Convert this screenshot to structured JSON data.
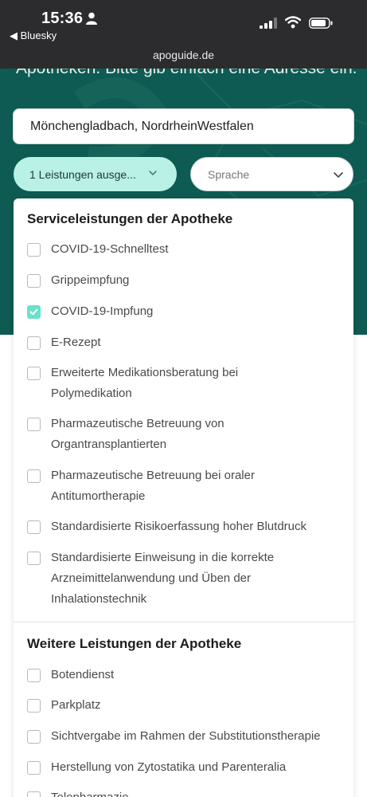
{
  "status_bar": {
    "time": "15:36",
    "back_app": "◀ Bluesky"
  },
  "browser": {
    "url": "apoguide.de"
  },
  "hero": {
    "text": "Apotheken. Bitte gib einfach eine Adresse ein.",
    "address_value": "Mönchengladbach, NordrheinWestfalen"
  },
  "filters": {
    "services_label": "1 Leistungen ausge...",
    "language_placeholder": "Sprache"
  },
  "sections": {
    "service": {
      "title": "Serviceleistungen der Apotheke",
      "items": [
        {
          "label": "COVID-19-Schnelltest",
          "checked": false
        },
        {
          "label": "Grippeimpfung",
          "checked": false
        },
        {
          "label": "COVID-19-Impfung",
          "checked": true
        },
        {
          "label": "E-Rezept",
          "checked": false
        },
        {
          "label": "Erweiterte Medikationsberatung bei Polymedikation",
          "checked": false
        },
        {
          "label": "Pharmazeutische Betreuung von Organtransplantierten",
          "checked": false
        },
        {
          "label": "Pharmazeutische Betreuung bei oraler Antitumortherapie",
          "checked": false
        },
        {
          "label": "Standardisierte Risikoerfassung hoher Blutdruck",
          "checked": false
        },
        {
          "label": "Standardisierte Einweisung in die korrekte Arzneimittelanwendung und Üben der Inhalationstechnik",
          "checked": false
        }
      ]
    },
    "further": {
      "title": "Weitere Leistungen der Apotheke",
      "items": [
        {
          "label": "Botendienst",
          "checked": false
        },
        {
          "label": "Parkplatz",
          "checked": false
        },
        {
          "label": "Sichtvergabe im Rahmen der Substitutionstherapie",
          "checked": false
        },
        {
          "label": "Herstellung von Zytostatika und Parenteralia",
          "checked": false
        },
        {
          "label": "Telepharmazie",
          "checked": false
        }
      ]
    }
  },
  "colors": {
    "hero_bg": "#0d5b52",
    "accent": "#6be0cc",
    "pill_selected": "#b9f1e6"
  }
}
